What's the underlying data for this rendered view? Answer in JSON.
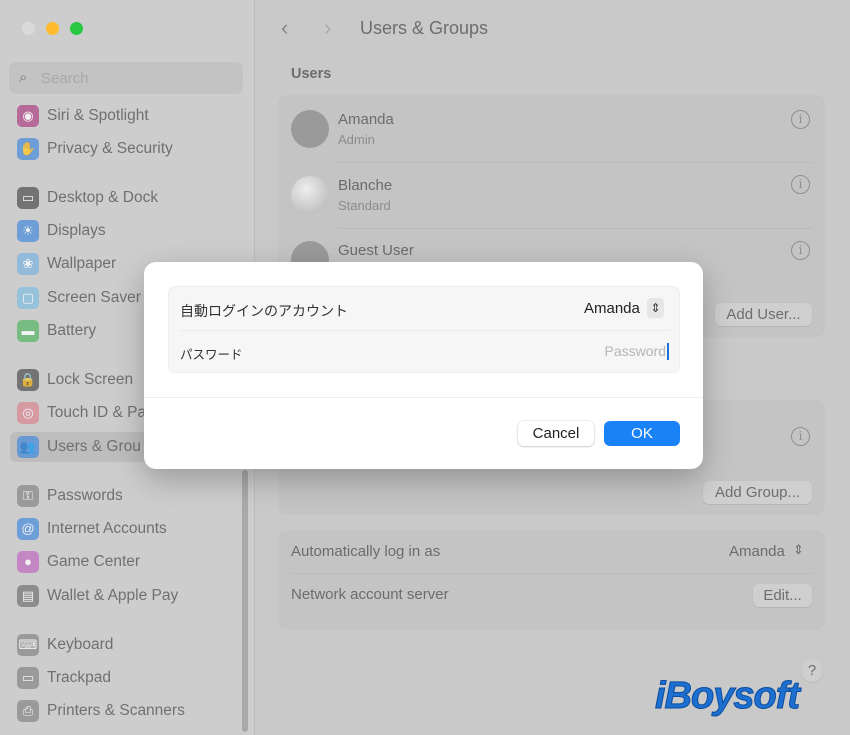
{
  "window": {
    "title": "Users & Groups",
    "traffic_lights": [
      "#dadada",
      "#febc2e",
      "#28c840"
    ]
  },
  "sidebar": {
    "search_placeholder": "Search",
    "items": [
      {
        "label": "Siri & Spotlight",
        "icon": "siri-icon",
        "color": "#b04a8a",
        "glyph": "◉"
      },
      {
        "label": "Privacy & Security",
        "icon": "hand-icon",
        "color": "#4f8fdc",
        "glyph": "✋"
      },
      {
        "label": "Desktop & Dock",
        "icon": "dock-icon",
        "color": "#555555",
        "glyph": "▭"
      },
      {
        "label": "Displays",
        "icon": "sun-icon",
        "color": "#4f8fdc",
        "glyph": "☀"
      },
      {
        "label": "Wallpaper",
        "icon": "wallpaper-icon",
        "color": "#7fb4e0",
        "glyph": "❀"
      },
      {
        "label": "Screen Saver",
        "icon": "screen-saver-icon",
        "color": "#86bfe0",
        "glyph": "▢"
      },
      {
        "label": "Battery",
        "icon": "battery-icon",
        "color": "#5bb86a",
        "glyph": "▬"
      },
      {
        "label": "Lock Screen",
        "icon": "lock-icon",
        "color": "#555555",
        "glyph": "🔒"
      },
      {
        "label": "Touch ID & Password",
        "display": "Touch ID & Pa",
        "icon": "fingerprint-icon",
        "color": "#d98a96",
        "glyph": "◎"
      },
      {
        "label": "Users & Groups",
        "display": "Users & Grou",
        "icon": "users-icon",
        "color": "#4f8fdc",
        "glyph": "👥",
        "selected": true
      },
      {
        "label": "Passwords",
        "icon": "key-icon",
        "color": "#8a8a8a",
        "glyph": "⚿"
      },
      {
        "label": "Internet Accounts",
        "icon": "at-icon",
        "color": "#4f8fdc",
        "glyph": "@"
      },
      {
        "label": "Game Center",
        "icon": "game-center-icon",
        "color": "#c070c0",
        "glyph": "●"
      },
      {
        "label": "Wallet & Apple Pay",
        "icon": "wallet-icon",
        "color": "#777777",
        "glyph": "▤"
      },
      {
        "label": "Keyboard",
        "icon": "keyboard-icon",
        "color": "#8a8a8a",
        "glyph": "⌨"
      },
      {
        "label": "Trackpad",
        "icon": "trackpad-icon",
        "color": "#8a8a8a",
        "glyph": "▭"
      },
      {
        "label": "Printers & Scanners",
        "icon": "printer-icon",
        "color": "#8a8a8a",
        "glyph": "⎙"
      }
    ]
  },
  "main": {
    "users_heading": "Users",
    "users": [
      {
        "name": "Amanda",
        "role": "Admin"
      },
      {
        "name": "Blanche",
        "role": "Standard"
      },
      {
        "name": "Guest User",
        "role": ""
      }
    ],
    "add_user": "Add User...",
    "add_group": "Add Group...",
    "auto_login_label": "Automatically log in as",
    "auto_login_value": "Amanda",
    "network_label": "Network account server",
    "edit": "Edit...",
    "help": "?"
  },
  "dialog": {
    "account_label": "自動ログインのアカウント",
    "account_value": "Amanda",
    "password_label": "パスワード",
    "password_placeholder": "Password",
    "cancel": "Cancel",
    "ok": "OK"
  },
  "watermark": "iBoysoft"
}
